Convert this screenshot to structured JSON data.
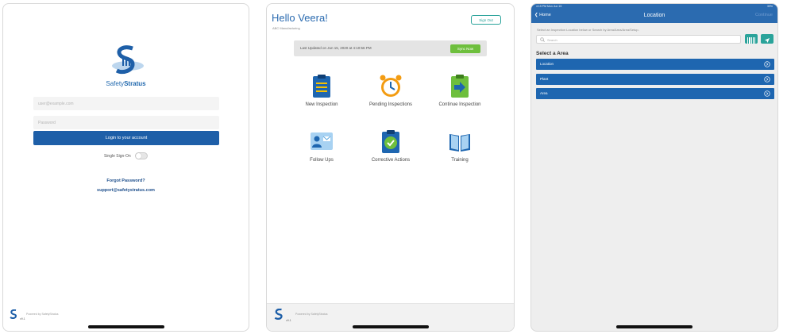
{
  "login": {
    "brand_part1": "Safety",
    "brand_part2": "Stratus",
    "email_placeholder": "user@example.com",
    "password_placeholder": "Password",
    "login_button": "Login to your account",
    "sso_label": "Single Sign-On",
    "sso_enabled": false,
    "forgot_password": "Forgot Password?",
    "support_email": "support@safetystratus.com",
    "powered_by": "Powered by SafetyStratus",
    "version": "v9.1"
  },
  "home": {
    "greeting": "Hello Veera!",
    "company": "ABC Manufacturing",
    "sign_out": "Sign Out",
    "last_updated": "Last Updated on Jun 15, 2020 at 4:10:56 PM",
    "sync_now": "Sync Now",
    "tiles": [
      {
        "label": "New Inspection",
        "icon": "clipboard-icon",
        "color": "#1e66b0"
      },
      {
        "label": "Pending Inspections",
        "icon": "alarm-clock-icon",
        "color": "#f39c12"
      },
      {
        "label": "Continue Inspection",
        "icon": "arrow-clipboard-icon",
        "color": "#6ebf3d"
      },
      {
        "label": "Follow Ups",
        "icon": "id-card-icon",
        "color": "#5aa7df"
      },
      {
        "label": "Corrective Actions",
        "icon": "check-clipboard-icon",
        "color": "#1e66b0"
      },
      {
        "label": "Training",
        "icon": "book-icon",
        "color": "#1e66b0"
      }
    ],
    "powered_by": "Powered by SafetyStratus",
    "version": "v9.1"
  },
  "location": {
    "status_time": "4:15 PM   Mon Jun 15",
    "status_right": "39%",
    "back_label": "Home",
    "title": "Location",
    "right_action": "Continue",
    "hint": "Select an Inspection Location below or Search by Area/Area/Area/Setup.",
    "search_placeholder": "Search",
    "select_area": "Select a Area",
    "areas": [
      "Location",
      "Plant",
      "Area"
    ]
  },
  "colors": {
    "brand_blue": "#1e5fa8",
    "nav_blue": "#2b6bb0",
    "teal": "#2aa39a",
    "green": "#6ebf3d"
  }
}
